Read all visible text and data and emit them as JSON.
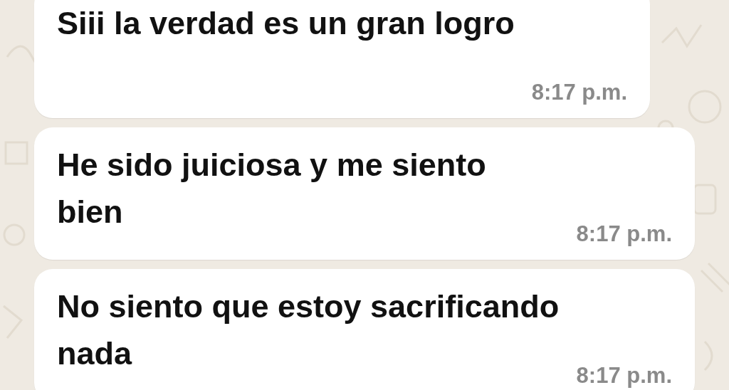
{
  "messages": [
    {
      "text": "Siii la verdad es un gran logro",
      "time": "8:17 p.m."
    },
    {
      "text": "He sido juiciosa y me siento bien",
      "time": "8:17 p.m."
    },
    {
      "text": "No siento que estoy sacrificando nada",
      "time": "8:17 p.m."
    }
  ]
}
